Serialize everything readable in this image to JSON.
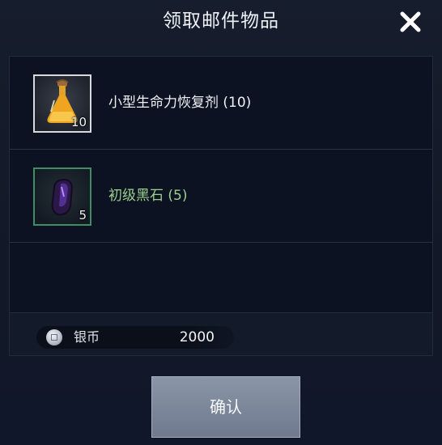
{
  "dialog": {
    "title": "领取邮件物品",
    "close_icon": "close-icon"
  },
  "items": [
    {
      "name": "小型生命力恢复剂 (10)",
      "quantity": "10",
      "icon": "potion-flask-icon",
      "rarity": "white",
      "rarity_color": "#d9d9d9",
      "text_color": "#eef0f4"
    },
    {
      "name": "初级黑石 (5)",
      "quantity": "5",
      "icon": "black-stone-icon",
      "rarity": "green",
      "rarity_color": "#3f8d62",
      "text_color": "#9bcf8e"
    }
  ],
  "currency": {
    "icon": "silver-coin-icon",
    "label": "银币",
    "value": "2000"
  },
  "confirm": {
    "label": "确认"
  }
}
